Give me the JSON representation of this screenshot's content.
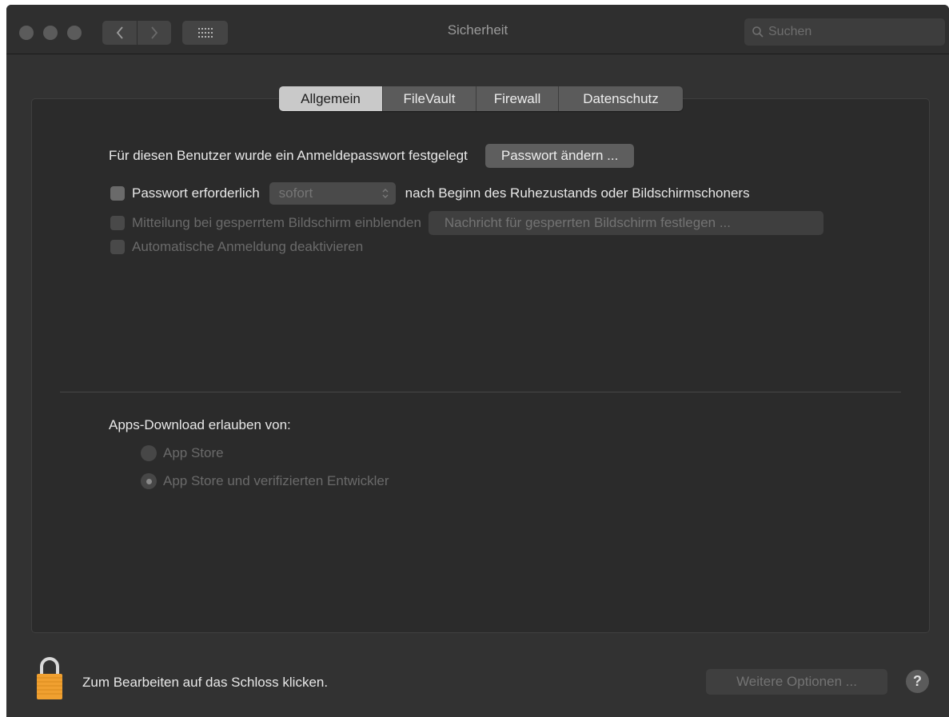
{
  "window": {
    "title": "Sicherheit",
    "search_placeholder": "Suchen",
    "icons": {
      "close": "traffic-close",
      "minimize": "traffic-minimize",
      "zoom": "traffic-zoom",
      "back": "chevron-left-icon",
      "forward": "chevron-right-icon",
      "grid": "grid-icon",
      "search": "search-icon"
    }
  },
  "tabs": [
    {
      "label": "Allgemein",
      "active": true
    },
    {
      "label": "FileVault",
      "active": false
    },
    {
      "label": "Firewall",
      "active": false
    },
    {
      "label": "Datenschutz",
      "active": false
    }
  ],
  "general": {
    "password_set_text": "Für diesen Benutzer wurde ein Anmeldepasswort festgelegt",
    "change_password_button": "Passwort ändern ...",
    "require_password_label": "Passwort erforderlich",
    "require_password_checked": false,
    "require_password_value": "sofort",
    "require_password_suffix": "nach Beginn des Ruhezustands oder Bildschirmschoners",
    "lock_message_label": "Mitteilung bei gesperrtem Bildschirm einblenden",
    "lock_message_button": "Nachricht für gesperrten Bildschirm festlegen ...",
    "disable_autologin_label": "Automatische Anmeldung deaktivieren"
  },
  "apps_download": {
    "heading": "Apps-Download erlauben von:",
    "options": [
      {
        "label": "App Store",
        "selected": false
      },
      {
        "label": "App Store und verifizierten Entwickler",
        "selected": true
      }
    ]
  },
  "footer": {
    "lock_text": "Zum Bearbeiten auf das Schloss klicken.",
    "more_options_button": "Weitere Optionen ...",
    "help_label": "?",
    "lock_icon": "lock-icon",
    "lock_color": "#f0a030"
  },
  "colors": {
    "window_bg": "#323232",
    "panel_bg": "#2b2b2b",
    "active_tab": "#c9c9c9"
  }
}
